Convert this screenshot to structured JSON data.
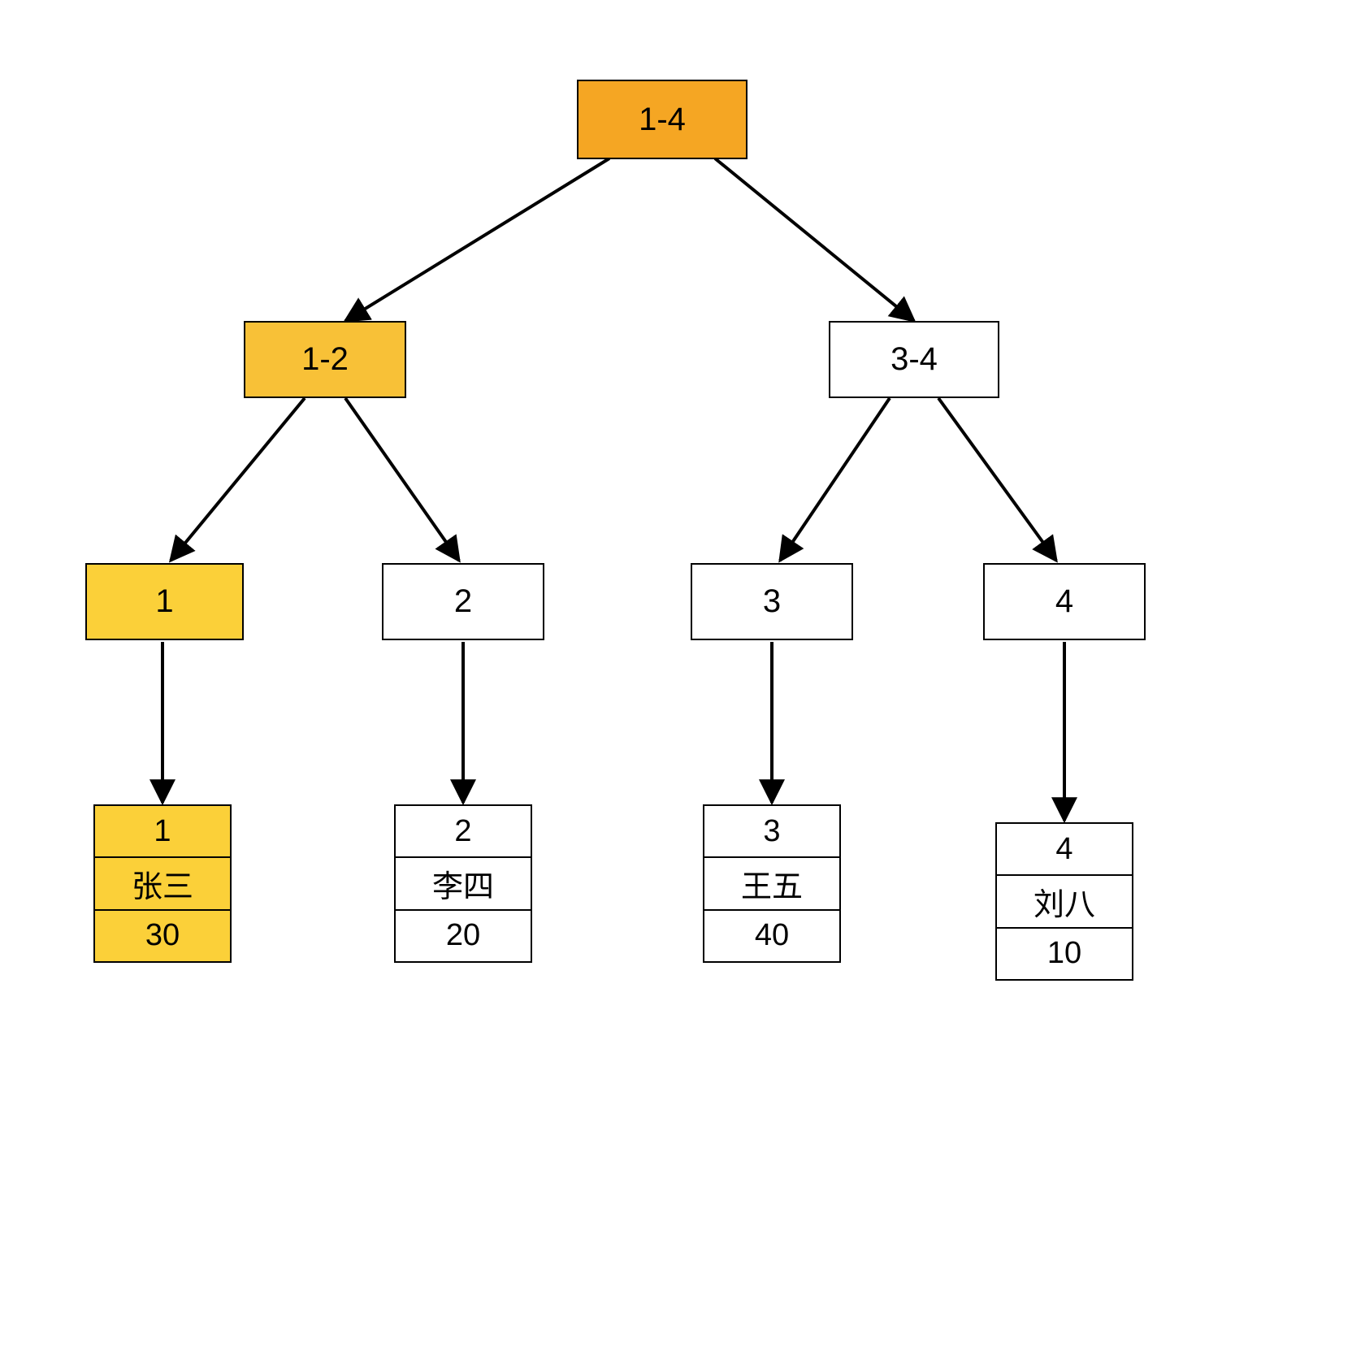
{
  "colors": {
    "highlight_root": "#f5a623",
    "highlight_mid": "#f8c137",
    "highlight_leaf": "#fbd039"
  },
  "nodes": {
    "root": {
      "label": "1-4"
    },
    "n12": {
      "label": "1-2"
    },
    "n34": {
      "label": "3-4"
    },
    "l1": {
      "label": "1"
    },
    "l2": {
      "label": "2"
    },
    "l3": {
      "label": "3"
    },
    "l4": {
      "label": "4"
    }
  },
  "records": {
    "r1": {
      "id": "1",
      "name": "张三",
      "value": "30"
    },
    "r2": {
      "id": "2",
      "name": "李四",
      "value": "20"
    },
    "r3": {
      "id": "3",
      "name": "王五",
      "value": "40"
    },
    "r4": {
      "id": "4",
      "name": "刘八",
      "value": "10"
    }
  },
  "chart_data": {
    "type": "tree",
    "description": "Segment/index tree with highlighted path from root to leaf 1",
    "highlighted_path": [
      "1-4",
      "1-2",
      "1",
      "record-1"
    ],
    "nodes": [
      {
        "id": "root",
        "label": "1-4",
        "children": [
          "n12",
          "n34"
        ],
        "highlighted": true
      },
      {
        "id": "n12",
        "label": "1-2",
        "children": [
          "l1",
          "l2"
        ],
        "highlighted": true
      },
      {
        "id": "n34",
        "label": "3-4",
        "children": [
          "l3",
          "l4"
        ],
        "highlighted": false
      },
      {
        "id": "l1",
        "label": "1",
        "children": [
          "r1"
        ],
        "highlighted": true
      },
      {
        "id": "l2",
        "label": "2",
        "children": [
          "r2"
        ],
        "highlighted": false
      },
      {
        "id": "l3",
        "label": "3",
        "children": [
          "r3"
        ],
        "highlighted": false
      },
      {
        "id": "l4",
        "label": "4",
        "children": [
          "r4"
        ],
        "highlighted": false
      }
    ],
    "records": [
      {
        "id": 1,
        "name": "张三",
        "value": 30,
        "highlighted": true
      },
      {
        "id": 2,
        "name": "李四",
        "value": 20,
        "highlighted": false
      },
      {
        "id": 3,
        "name": "王五",
        "value": 40,
        "highlighted": false
      },
      {
        "id": 4,
        "name": "刘八",
        "value": 10,
        "highlighted": false
      }
    ]
  }
}
